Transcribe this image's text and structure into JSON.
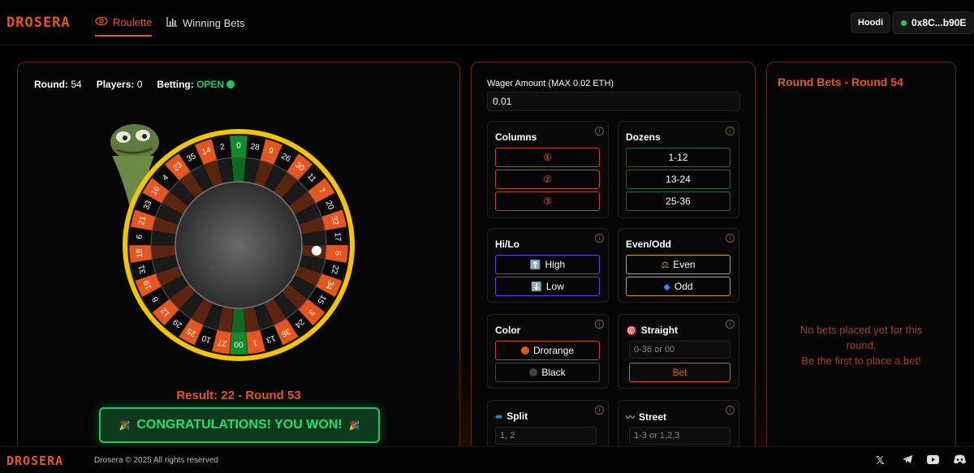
{
  "brand": {
    "logo_text": "DROSERA",
    "accent": "#e8561f"
  },
  "nav": {
    "tabs": [
      {
        "label": "Roulette",
        "icon": "eye-icon",
        "active": true
      },
      {
        "label": "Winning Bets",
        "icon": "bar-chart-icon",
        "active": false
      }
    ]
  },
  "header": {
    "network": "Hoodi",
    "wallet": "0x8C...b90E"
  },
  "game": {
    "round_label": "Round:",
    "round_value": "54",
    "players_label": "Players:",
    "players_value": "0",
    "betting_label": "Betting:",
    "betting_value": "OPEN",
    "result": "Result: 22 - Round 53",
    "congrats": "CONGRATULATIONS! YOU WON!",
    "wheel_numbers": [
      "0",
      "28",
      "9",
      "26",
      "30",
      "11",
      "7",
      "20",
      "32",
      "17",
      "5",
      "22",
      "34",
      "15",
      "3",
      "24",
      "36",
      "13",
      "1",
      "00",
      "27",
      "10",
      "25",
      "29",
      "12",
      "8",
      "19",
      "31",
      "18",
      "6",
      "21",
      "33",
      "16",
      "4",
      "23",
      "35",
      "14",
      "2"
    ]
  },
  "wager": {
    "label": "Wager Amount (MAX 0.02 ETH)",
    "value": "0.01"
  },
  "bets": {
    "columns": {
      "title": "Columns",
      "options": [
        "①",
        "②",
        "③"
      ]
    },
    "dozens": {
      "title": "Dozens",
      "options": [
        "1-12",
        "13-24",
        "25-36"
      ]
    },
    "hilo": {
      "title": "Hi/Lo",
      "options": [
        "High",
        "Low"
      ]
    },
    "evenodd": {
      "title": "Even/Odd",
      "options": [
        "Even",
        "Odd"
      ]
    },
    "color": {
      "title": "Color",
      "options": [
        "Drorange",
        "Black"
      ]
    },
    "straight": {
      "title": "Straight",
      "placeholder": "0-36 or 00",
      "button": "Bet"
    },
    "split": {
      "title": "Split",
      "placeholder": "1, 2"
    },
    "street": {
      "title": "Street",
      "placeholder": "1-3 or 1,2,3"
    }
  },
  "round_bets": {
    "title": "Round Bets - Round 54",
    "empty_line1": "No bets placed yet for this round.",
    "empty_line2": "Be the first to place a bet!"
  },
  "footer": {
    "logo_text": "DROSERA",
    "copyright": "Drosera © 2025 All rights reserved",
    "social_icons": [
      "x-icon",
      "telegram-icon",
      "youtube-icon",
      "discord-icon"
    ]
  }
}
